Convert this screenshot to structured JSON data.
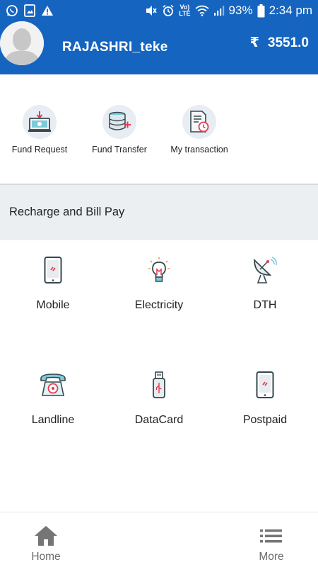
{
  "status_bar": {
    "volte_top": "Vo)",
    "volte_bottom": "LTE",
    "battery_percent": "93%",
    "time": "2:34 pm",
    "icons": [
      "whatsapp-icon",
      "image-notification-icon",
      "warning-icon",
      "mute-icon",
      "alarm-icon",
      "wifi-icon",
      "signal-icon",
      "battery-icon"
    ]
  },
  "header": {
    "user_name": "RAJASHRI_teke",
    "currency_symbol": "₹",
    "balance": "3551.0",
    "color": "#1565c0"
  },
  "quick_actions": [
    {
      "label": "Fund Request",
      "icon": "fund-request-icon"
    },
    {
      "label": "Fund Transfer",
      "icon": "fund-transfer-icon"
    },
    {
      "label": "My transaction",
      "icon": "transaction-receipt-icon"
    }
  ],
  "section": {
    "title": "Recharge and Bill Pay"
  },
  "services": [
    {
      "label": "Mobile",
      "icon": "mobile-phone-icon"
    },
    {
      "label": "Electricity",
      "icon": "lightbulb-icon"
    },
    {
      "label": "DTH",
      "icon": "satellite-dish-icon"
    },
    {
      "label": "Landline",
      "icon": "telephone-icon"
    },
    {
      "label": "DataCard",
      "icon": "usb-datacard-icon"
    },
    {
      "label": "Postpaid",
      "icon": "postpaid-phone-icon"
    }
  ],
  "bottom_nav": {
    "home_label": "Home",
    "more_label": "More"
  }
}
